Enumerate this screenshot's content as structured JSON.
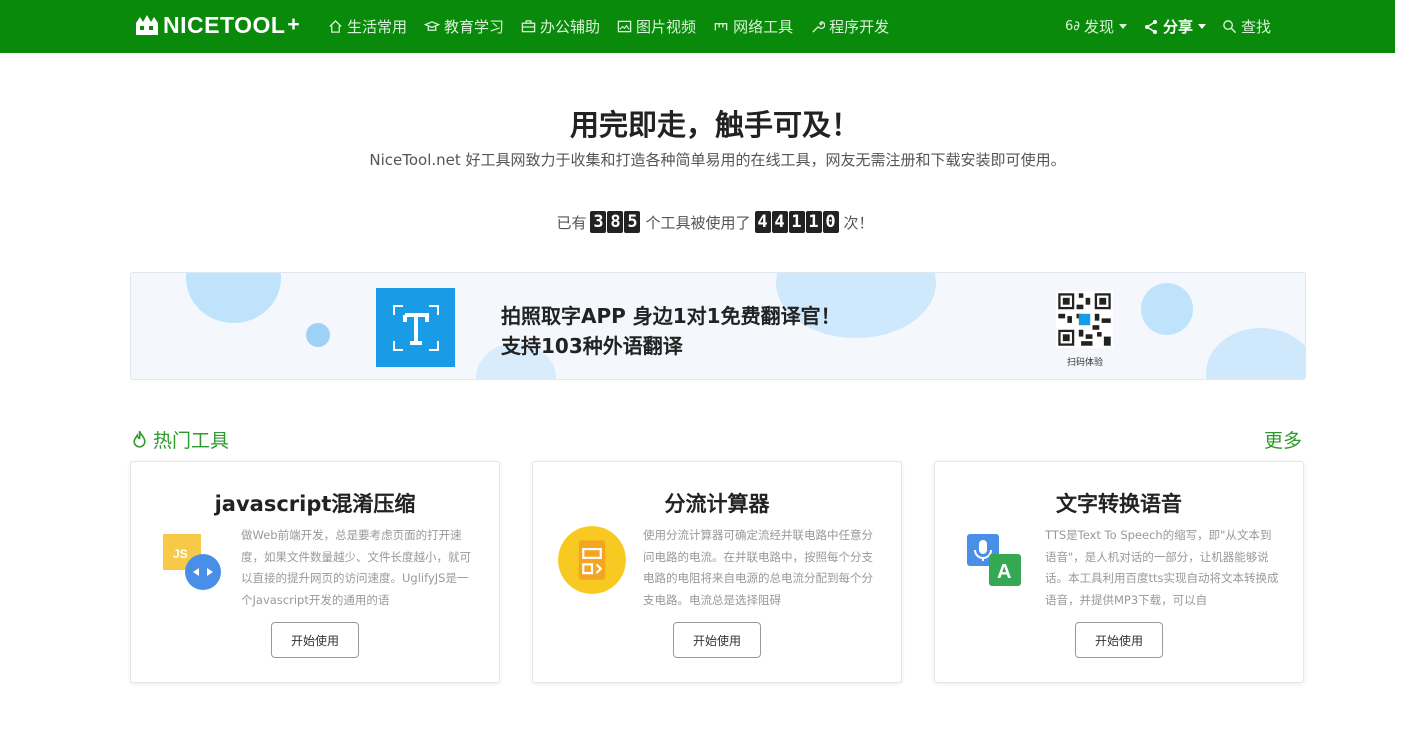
{
  "nav": {
    "brand": "NICETOOL",
    "items": [
      {
        "label": "生活常用",
        "icon": "home-icon"
      },
      {
        "label": "教育学习",
        "icon": "graduation-cap-icon"
      },
      {
        "label": "办公辅助",
        "icon": "briefcase-icon"
      },
      {
        "label": "图片视频",
        "icon": "image-icon"
      },
      {
        "label": "网络工具",
        "icon": "network-icon"
      },
      {
        "label": "程序开发",
        "icon": "wrench-icon"
      }
    ],
    "discover": "发现",
    "share": "分享",
    "search": "查找"
  },
  "hero": {
    "title": "用完即走，触手可及！",
    "description": "NiceTool.net 好工具网致力于收集和打造各种简单易用的在线工具，网友无需注册和下载安装即可使用。",
    "counter_prefix": "已有",
    "tool_count": "385",
    "counter_middle": "个工具被使用了",
    "use_count": "44110",
    "counter_suffix": "次！"
  },
  "banner": {
    "line1": "拍照取字APP 身边1对1免费翻译官！",
    "line2": "支持103种外语翻译",
    "qr_label": "扫码体验",
    "colors": {
      "background": "#f4f8fc",
      "blob": "#bfe3fb",
      "app_icon": "#1a9be6"
    }
  },
  "hot_tools": {
    "heading": "热门工具",
    "more": "更多",
    "cards": [
      {
        "title": "javascript混淆压缩",
        "icon": "javascript-compress-icon",
        "description": "做Web前端开发，总是要考虑页面的打开速度，如果文件数量越少、文件长度越小，就可以直接的提升网页的访问速度。UglifyJS是一个Javascript开发的通用的语",
        "button": "开始使用"
      },
      {
        "title": "分流计算器",
        "icon": "shunt-calculator-icon",
        "description": "使用分流计算器可确定流经并联电路中任意分问电路的电流。在并联电路中，按照每个分支电路的电阻将来自电源的总电流分配到每个分支电路。电流总是选择阻碍",
        "button": "开始使用"
      },
      {
        "title": "文字转换语音",
        "icon": "text-to-speech-icon",
        "description": "TTS是Text To Speech的缩写，即\"从文本到语音\"，是人机对话的一部分，让机器能够说话。本工具利用百度tts实现自动将文本转换成语音，并提供MP3下载，可以自",
        "button": "开始使用"
      }
    ]
  },
  "colors": {
    "navbar": "#0a8a0a",
    "accent_green": "#2e9a2e"
  }
}
